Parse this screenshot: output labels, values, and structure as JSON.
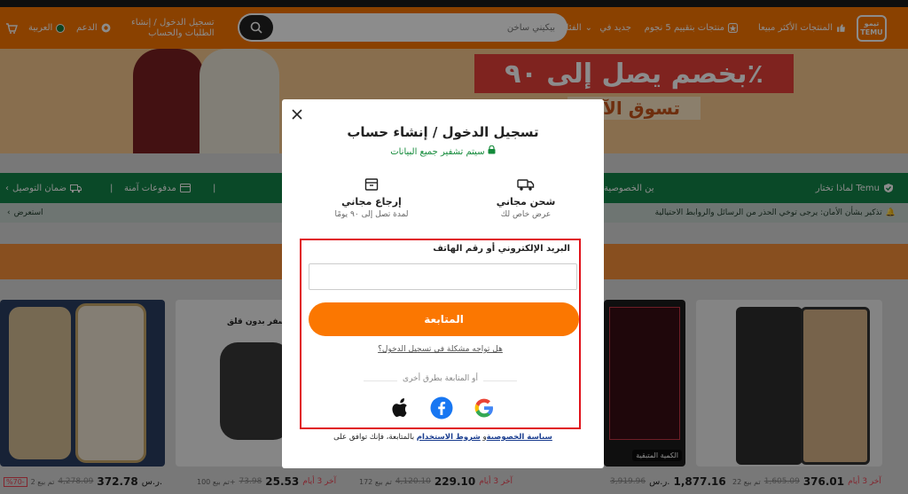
{
  "header": {
    "logo_line1": "تيمو",
    "logo_line2": "TEMU",
    "nav": {
      "best_sellers": "المنتجات الأكثر مبيعا",
      "five_star": "منتجات بتقييم 5 نجوم",
      "new": "جديد في",
      "categories": "الفئات"
    },
    "search_placeholder": "بيكيني ساخن",
    "account_line1": "تسجيل الدخول / إنشاء",
    "account_line2": "الطلبات والحساب",
    "support": "الدعم",
    "language": "العربية",
    "accent": "#fb7701"
  },
  "hero": {
    "promo_text": "بخصم يصل إلى ٩٠٪",
    "shop_text": "تسوق الآن"
  },
  "trust_bar": {
    "why_temu": "لماذا تختار Temu",
    "privacy": "ين الخصوصية",
    "secure_payments": "مدفوعات آمنة",
    "delivery_guarantee": "ضمان التوصيل"
  },
  "notice": {
    "text": "تذكير بشأن الأمان: يرجى توخي الحذر من الرسائل والروابط الاحتيالية",
    "view": "استعرض"
  },
  "products": [
    {
      "price": "372.78",
      "currency": "ر.س.",
      "old": "4,278.09",
      "badge": "%70-",
      "note": "تم بيع 2"
    },
    {
      "price": "25.53",
      "currency": "ر.س.",
      "old": "73.98",
      "note": "تم بيع 100+",
      "days": "آخر 3 أيام"
    },
    {
      "price": "229.10",
      "currency": "ر.س.",
      "old": "4,120.10",
      "note": "تم بيع 172",
      "days": "آخر 3 أيام"
    },
    {
      "price": "1,877.16",
      "currency": "ر.س.",
      "old": "3,919.96"
    },
    {
      "price": "376.01",
      "currency": "ر.س.",
      "old": "1,605.09",
      "note": "تم بيع 22",
      "days": "آخر 3 أيام"
    }
  ],
  "product_labels": {
    "shaver_top": "سفر بدون قلق",
    "pc_label": "الكمية المتبقية"
  },
  "modal": {
    "title": "تسجيل الدخول / إنشاء حساب",
    "encrypted": "سيتم تشفير جميع البيانات",
    "free_shipping_title": "شحن مجاني",
    "free_shipping_sub": "عرض خاص لك",
    "free_return_title": "إرجاع مجاني",
    "free_return_sub": "لمدة تصل إلى ٩٠ يومًا",
    "field_label": "البريد الإلكتروني أو رقم الهاتف",
    "field_value": "",
    "continue_label": "المتابعة",
    "trouble_link": "هل تواجه مشكلة في تسجيل الدخول؟",
    "other_ways": "أو المتابعة بطرق أخرى",
    "terms_prefix": "بالمتابعة، فإنك توافق على",
    "terms_link": "شروط الاستخدام",
    "and": "و",
    "privacy_link": "سياسة الخصوصية",
    "button_color": "#fb7701",
    "highlight_color": "#e0131b"
  }
}
